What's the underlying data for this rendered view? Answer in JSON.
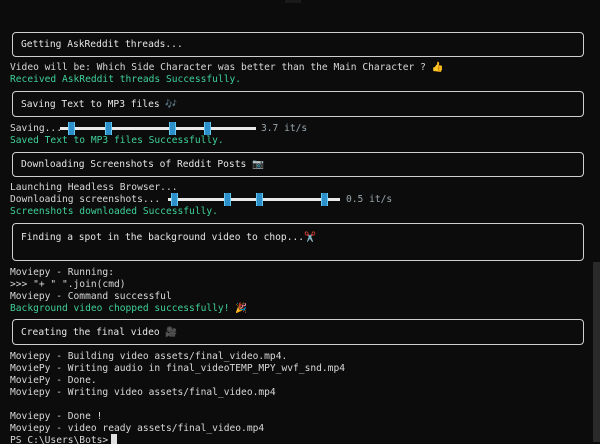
{
  "terminal": {
    "box1": "Getting AskReddit threads...",
    "video_line": "Video will be: Which Side Character was better than the Main Character ? 👍",
    "received": "Received AskReddit threads Successfully.",
    "box2": "Saving Text to MP3 files 🎶",
    "saving_label": "Saving...",
    "saving_rate": "3.7 it/s",
    "saving_progress": 1.0,
    "saved": "Saved Text to MP3 files Successfully.",
    "box3": "Downloading Screenshots of Reddit Posts 📷",
    "launching": "Launching Headless Browser...",
    "downloading_label": "Downloading screenshots...",
    "downloading_rate": "0.5 it/s",
    "downloading_progress": 1.0,
    "screenshots_done": "Screenshots downloaded Successfully.",
    "box4": "Finding a spot in the background video to chop...✂️",
    "mp_running": "Moviepy - Running:",
    "mp_join": ">>> \"+ \" \".join(cmd)",
    "mp_cmd_success": "Moviepy - Command successful",
    "bg_chopped": "Background video chopped successfully! 🎉",
    "box5": "Creating the final video 🎥",
    "build1": "Moviepy - Building video assets/final_video.mp4.",
    "build2": "MoviePy - Writing audio in final_videoTEMP_MPY_wvf_snd.mp4",
    "build3": "MoviePy - Done.",
    "build4": "Moviepy - Writing video assets/final_video.mp4",
    "done1": "Moviepy - Done !",
    "done2": "Moviepy - video ready assets/final_video.mp4",
    "prompt": "PS C:\\Users\\Bots>"
  },
  "colors": {
    "background": "#0c0c0c",
    "text": "#d8d8d8",
    "success": "#3fd09a",
    "progress_handle": "#2d8fc9",
    "box_border": "#cfcfcf"
  }
}
